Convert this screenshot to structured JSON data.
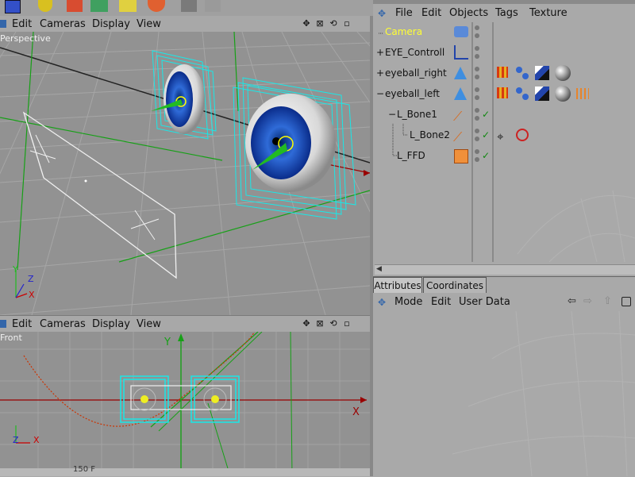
{
  "viewport_menu": {
    "edit": "Edit",
    "cameras": "Cameras",
    "display": "Display",
    "view": "View"
  },
  "perspective": {
    "label": "Perspective"
  },
  "front": {
    "label": "Front",
    "axis_y": "Y",
    "axis_x": "X"
  },
  "axes_small": {
    "y": "Y",
    "z": "Z",
    "x": "X"
  },
  "object_manager": {
    "menu": {
      "file": "File",
      "edit": "Edit",
      "objects": "Objects",
      "tags": "Tags",
      "texture": "Texture"
    },
    "objects": [
      {
        "name": "Camera",
        "prefix": "",
        "color": "#ffff33"
      },
      {
        "name": "EYE_Controll",
        "prefix": "+",
        "color": "#111111"
      },
      {
        "name": "eyeball_right",
        "prefix": "+",
        "color": "#111111"
      },
      {
        "name": "eyeball_left",
        "prefix": "−",
        "color": "#111111"
      },
      {
        "name": "L_Bone1",
        "prefix": "−",
        "color": "#111111"
      },
      {
        "name": "L_Bone2",
        "prefix": "",
        "color": "#111111"
      },
      {
        "name": "L_FFD",
        "prefix": "",
        "color": "#111111"
      }
    ]
  },
  "attributes": {
    "tab_attributes": "Attributes",
    "tab_coordinates": "Coordinates",
    "menu": {
      "mode": "Mode",
      "edit": "Edit",
      "user_data": "User Data"
    }
  },
  "statusbar": {
    "value": "150 F"
  },
  "colors": {
    "selection": "#00ffff",
    "bone": "#00cc00",
    "curve": "#cc3300",
    "axis_x": "#cc0000",
    "axis_z": "#2222cc"
  }
}
